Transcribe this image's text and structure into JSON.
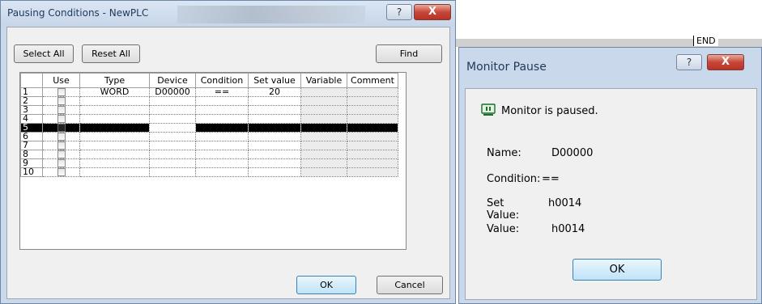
{
  "dialog1": {
    "title": "Pausing Conditions - NewPLC",
    "buttons": {
      "select_all": "Select All",
      "reset_all": "Reset All",
      "find": "Find",
      "ok": "OK",
      "cancel": "Cancel"
    },
    "columns": [
      "Use",
      "Type",
      "Device",
      "Condition",
      "Set value",
      "Variable",
      "Comment"
    ],
    "rows": [
      {
        "num": "1",
        "type": "WORD",
        "device": "D00000",
        "condition": "==",
        "set_value": "20",
        "variable": "",
        "comment": ""
      },
      {
        "num": "2",
        "type": "",
        "device": "",
        "condition": "",
        "set_value": "",
        "variable": "",
        "comment": ""
      },
      {
        "num": "3",
        "type": "",
        "device": "",
        "condition": "",
        "set_value": "",
        "variable": "",
        "comment": ""
      },
      {
        "num": "4",
        "type": "",
        "device": "",
        "condition": "",
        "set_value": "",
        "variable": "",
        "comment": ""
      },
      {
        "num": "5",
        "type": "",
        "device": "",
        "condition": "",
        "set_value": "",
        "variable": "",
        "comment": ""
      },
      {
        "num": "6",
        "type": "",
        "device": "",
        "condition": "",
        "set_value": "",
        "variable": "",
        "comment": ""
      },
      {
        "num": "7",
        "type": "",
        "device": "",
        "condition": "",
        "set_value": "",
        "variable": "",
        "comment": ""
      },
      {
        "num": "8",
        "type": "",
        "device": "",
        "condition": "",
        "set_value": "",
        "variable": "",
        "comment": ""
      },
      {
        "num": "9",
        "type": "",
        "device": "",
        "condition": "",
        "set_value": "",
        "variable": "",
        "comment": ""
      },
      {
        "num": "10",
        "type": "",
        "device": "",
        "condition": "",
        "set_value": "",
        "variable": "",
        "comment": ""
      }
    ],
    "selected_row": 5
  },
  "background": {
    "end_label": "END"
  },
  "dialog2": {
    "title": "Monitor Pause",
    "message": "Monitor is paused.",
    "fields": [
      {
        "label": "Name:",
        "value": "D00000"
      },
      {
        "label": "Condition:",
        "value": "=="
      },
      {
        "label": "Set Value:",
        "value": "h0014"
      },
      {
        "label": "Value:",
        "value": "h0014"
      }
    ],
    "ok": "OK"
  },
  "caption": {
    "help_glyph": "?",
    "close_glyph": "X"
  },
  "icons": [
    "help-icon",
    "close-icon",
    "monitor-icon",
    "checkbox-icon"
  ],
  "colors": {
    "titlebar": "#c9d8ea",
    "close_button": "#c6463a",
    "selected_row": "#000000"
  }
}
